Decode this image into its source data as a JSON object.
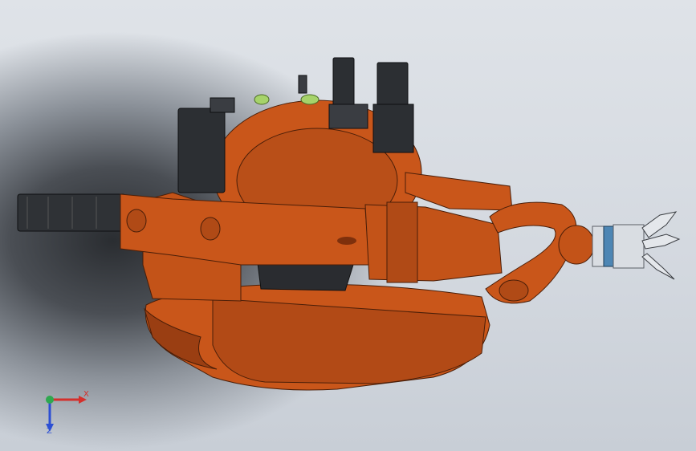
{
  "viewport": {
    "model": "industrial-robot-arm-with-gripper",
    "colors": {
      "robot_body": "#c9561a",
      "robot_shadow": "#7e300c",
      "robot_highlight": "#e07a3a",
      "motor_dark": "#2c2f33",
      "accent_green": "#a6d36a",
      "gripper_blue": "#4d86b4",
      "gripper_silver": "#d9dde2"
    }
  },
  "triad": {
    "x_label": "X",
    "z_label": "Z",
    "x_color": "#d4302c",
    "y_color": "#2fa84f",
    "z_color": "#2c4fd4"
  }
}
